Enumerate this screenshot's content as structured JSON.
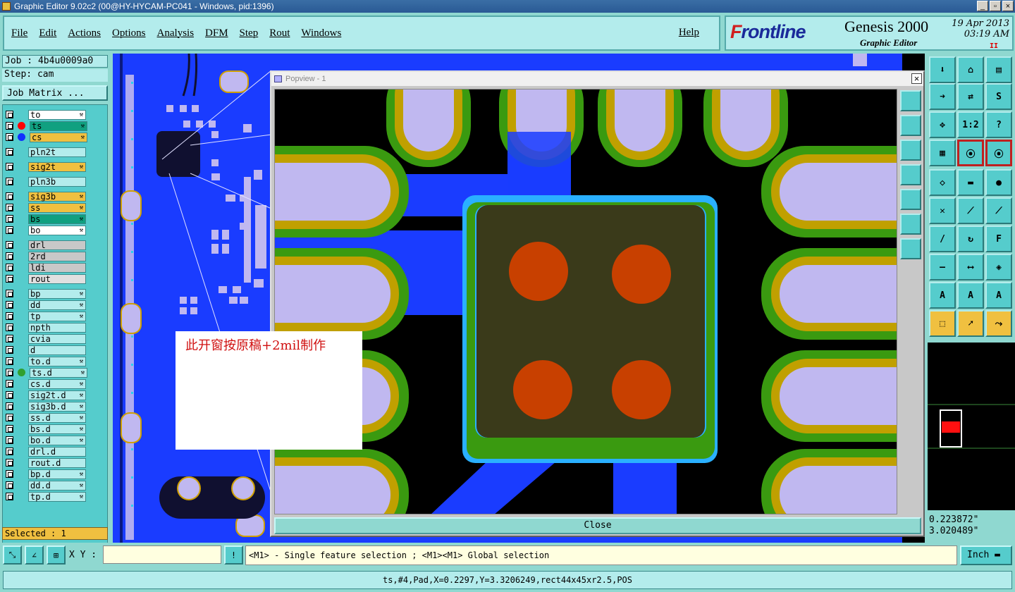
{
  "window": {
    "title": "Graphic Editor 9.02c2 (00@HY-HYCAM-PC041 - Windows, pid:1396)",
    "min": "_",
    "max": "▫",
    "close": "×"
  },
  "menu": {
    "items": [
      "File",
      "Edit",
      "Actions",
      "Options",
      "Analysis",
      "DFM",
      "Step",
      "Rout",
      "Windows"
    ],
    "help": "Help"
  },
  "brand": {
    "logo_pre": "F",
    "logo_rest": "rontline",
    "product": "Genesis 2000",
    "subtitle": "Graphic Editor",
    "date": "19 Apr 2013",
    "time": "03:19 AM",
    "pause": "II"
  },
  "job": {
    "job": "Job : 4b4u0009a0",
    "step": "Step: cam",
    "matrix_button": "Job Matrix ..."
  },
  "layers": [
    {
      "name": "to",
      "color": "#ffffff",
      "ed": true
    },
    {
      "name": "ts",
      "color": "#10a080",
      "ed": true,
      "active": true
    },
    {
      "name": "cs",
      "color": "#f0c040",
      "ed": true
    },
    {
      "name": "pln2t",
      "color": "#b3ecec"
    },
    {
      "name": "sig2t",
      "color": "#f0c040",
      "ed": true
    },
    {
      "name": "pln3b",
      "color": "#b3ecec"
    },
    {
      "name": "sig3b",
      "color": "#f0c040",
      "ed": true
    },
    {
      "name": "ss",
      "color": "#f0c040",
      "ed": true
    },
    {
      "name": "bs",
      "color": "#10a080",
      "ed": true
    },
    {
      "name": "bo",
      "color": "#ffffff",
      "ed": true
    },
    {
      "name": "drl",
      "color": "#c8c8c8"
    },
    {
      "name": "2rd",
      "color": "#c8c8c8"
    },
    {
      "name": "ldi",
      "color": "#c8c8c8"
    },
    {
      "name": "rout",
      "color": "#e0e0e0"
    },
    {
      "name": "bp",
      "color": "#b3ecec",
      "ed": true
    },
    {
      "name": "dd",
      "color": "#b3ecec",
      "ed": true
    },
    {
      "name": "tp",
      "color": "#b3ecec",
      "ed": true
    },
    {
      "name": "npth",
      "color": "#b3ecec"
    },
    {
      "name": "cvia",
      "color": "#b3ecec"
    },
    {
      "name": "d",
      "color": "#b3ecec"
    },
    {
      "name": "to.d",
      "color": "#b3ecec",
      "ed": true
    },
    {
      "name": "ts.d",
      "color": "#b3ecec",
      "ed": true
    },
    {
      "name": "cs.d",
      "color": "#b3ecec",
      "ed": true
    },
    {
      "name": "sig2t.d",
      "color": "#b3ecec",
      "ed": true
    },
    {
      "name": "sig3b.d",
      "color": "#b3ecec",
      "ed": true
    },
    {
      "name": "ss.d",
      "color": "#b3ecec",
      "ed": true
    },
    {
      "name": "bs.d",
      "color": "#b3ecec",
      "ed": true
    },
    {
      "name": "bo.d",
      "color": "#b3ecec",
      "ed": true
    },
    {
      "name": "drl.d",
      "color": "#b3ecec"
    },
    {
      "name": "rout.d",
      "color": "#b3ecec"
    },
    {
      "name": "bp.d",
      "color": "#b3ecec",
      "ed": true
    },
    {
      "name": "dd.d",
      "color": "#b3ecec",
      "ed": true
    },
    {
      "name": "tp.d",
      "color": "#b3ecec",
      "ed": true
    }
  ],
  "selected": "Selected : 1",
  "popview": {
    "title": "Popview - 1",
    "close_label": "Close"
  },
  "note": "此开窗按原稿+2mil制作",
  "coords": {
    "x": "0.223872\"",
    "y": "3.020489\""
  },
  "bottom": {
    "xy_label": "X Y :",
    "xy_value": "",
    "message": "<M1> - Single feature selection ; <M1><M1> Global selection",
    "unit": "Inch"
  },
  "status": "ts,#4,Pad,X=0.2297,Y=3.3206249,rect44x45xr2.5,POS",
  "toolbar_labels": {
    "ratio": "1:2",
    "help": "?"
  }
}
